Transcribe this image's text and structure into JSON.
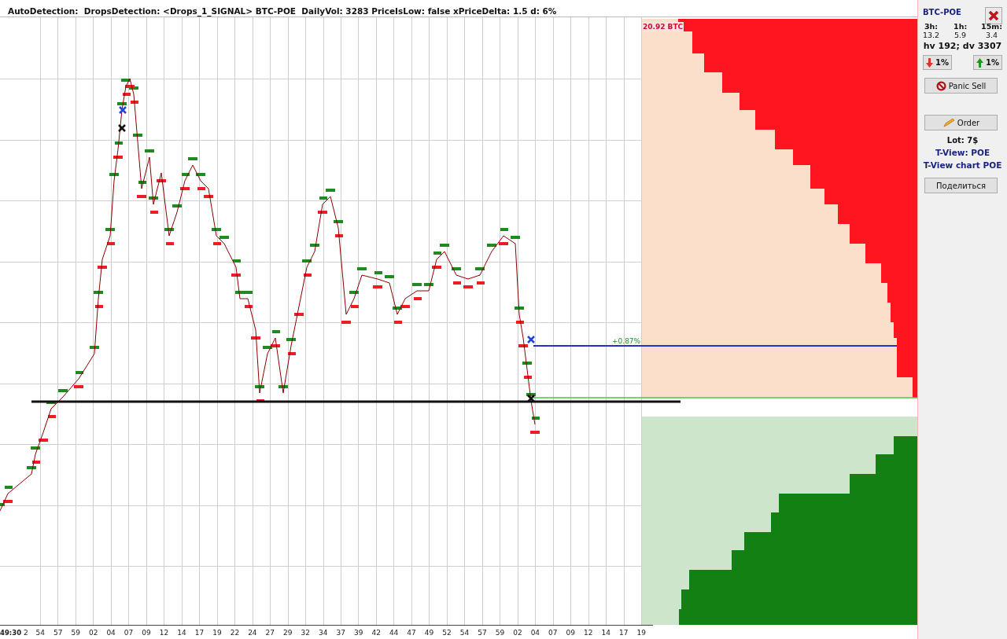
{
  "title": "AutoDetection:  DropsDetection: <Drops_1_SIGNAL> BTC-POE  DailyVol: 3283 PriceIsLow: false xPriceDelta: 1.5 d: 6%",
  "chart": {
    "change_label": "+0.87%",
    "volume_label": "20.92 BTC",
    "time_labels": [
      "49:30",
      "2",
      "54",
      "57",
      "59",
      "02",
      "04",
      "07",
      "09",
      "12",
      "14",
      "17",
      "19",
      "22",
      "24",
      "27",
      "29",
      "32",
      "34",
      "37",
      "39",
      "42",
      "44",
      "47",
      "49",
      "52",
      "54",
      "57",
      "59",
      "02",
      "04",
      "07",
      "09",
      "12",
      "14",
      "17",
      "19"
    ]
  },
  "panel": {
    "pair": "BTC-POE",
    "stats": [
      {
        "period": "3h:",
        "value": "13.2"
      },
      {
        "period": "1h:",
        "value": "5.9"
      },
      {
        "period": "15m:",
        "value": "3.4"
      }
    ],
    "summary": "hv 192; dv 3307",
    "steps": [
      {
        "kind": "down",
        "label": "1%"
      },
      {
        "kind": "up",
        "label": "1%"
      }
    ],
    "panic": "Panic Sell",
    "order": "Order",
    "lot": "Lot: 7$",
    "links": [
      "T-View: POE",
      "T-View chart POE"
    ],
    "share": "Поделиться"
  }
}
